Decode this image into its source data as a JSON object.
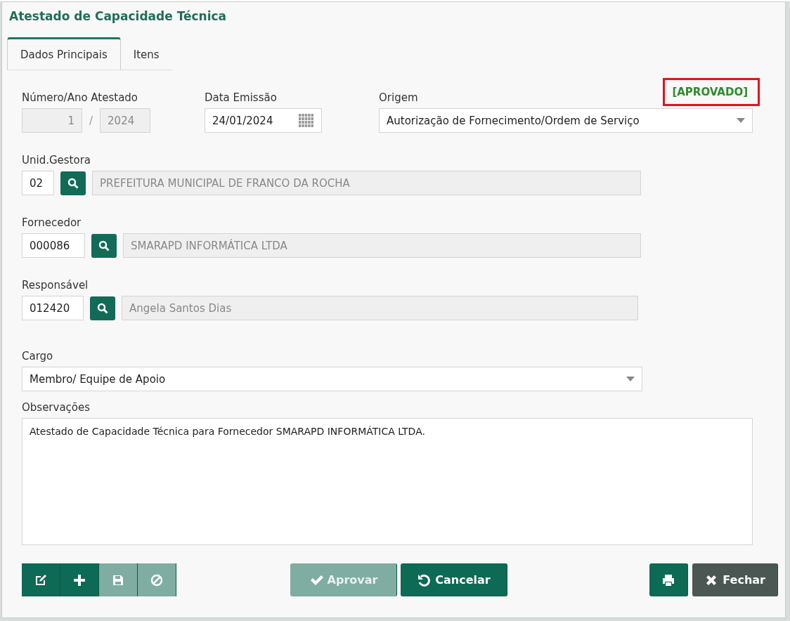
{
  "window": {
    "title": "Atestado de Capacidade Técnica"
  },
  "tabs": [
    {
      "label": "Dados Principais",
      "selected": true
    },
    {
      "label": "Itens",
      "selected": false
    }
  ],
  "status": "[APROVADO]",
  "numero_ano": {
    "label": "Número/Ano Atestado",
    "number": "1",
    "separator": "/",
    "year": "2024"
  },
  "data_emissao": {
    "label": "Data Emissão",
    "value": "24/01/2024"
  },
  "origem": {
    "label": "Origem",
    "value": "Autorização de Fornecimento/Ordem de Serviço"
  },
  "lookups": [
    {
      "label": "Unid.Gestora",
      "code": "02",
      "name": "PREFEITURA MUNICIPAL DE FRANCO DA ROCHA"
    },
    {
      "label": "Fornecedor",
      "code": "000086",
      "name": "SMARAPD INFORMÁTICA LTDA"
    },
    {
      "label": "Responsável",
      "code": "012420",
      "name": "Angela Santos Dias"
    }
  ],
  "cargo": {
    "label": "Cargo",
    "value": "Membro/ Equipe de Apoio"
  },
  "observacoes": {
    "label": "Observações",
    "value": "Atestado de Capacidade Técnica para Fornecedor SMARAPD INFORMÁTICA LTDA."
  },
  "toolbar_left": [
    {
      "kind": "edit",
      "disabled": false
    },
    {
      "kind": "add",
      "disabled": false
    },
    {
      "kind": "save",
      "disabled": true
    },
    {
      "kind": "block",
      "disabled": true
    }
  ],
  "toolbar_center": [
    {
      "kind": "approve",
      "label": "Aprovar",
      "disabled": true
    },
    {
      "kind": "undo",
      "label": "Cancelar",
      "disabled": false
    }
  ],
  "toolbar_right": [
    {
      "kind": "print",
      "disabled": false
    },
    {
      "kind": "close",
      "label": "Fechar",
      "disabled": false
    }
  ]
}
